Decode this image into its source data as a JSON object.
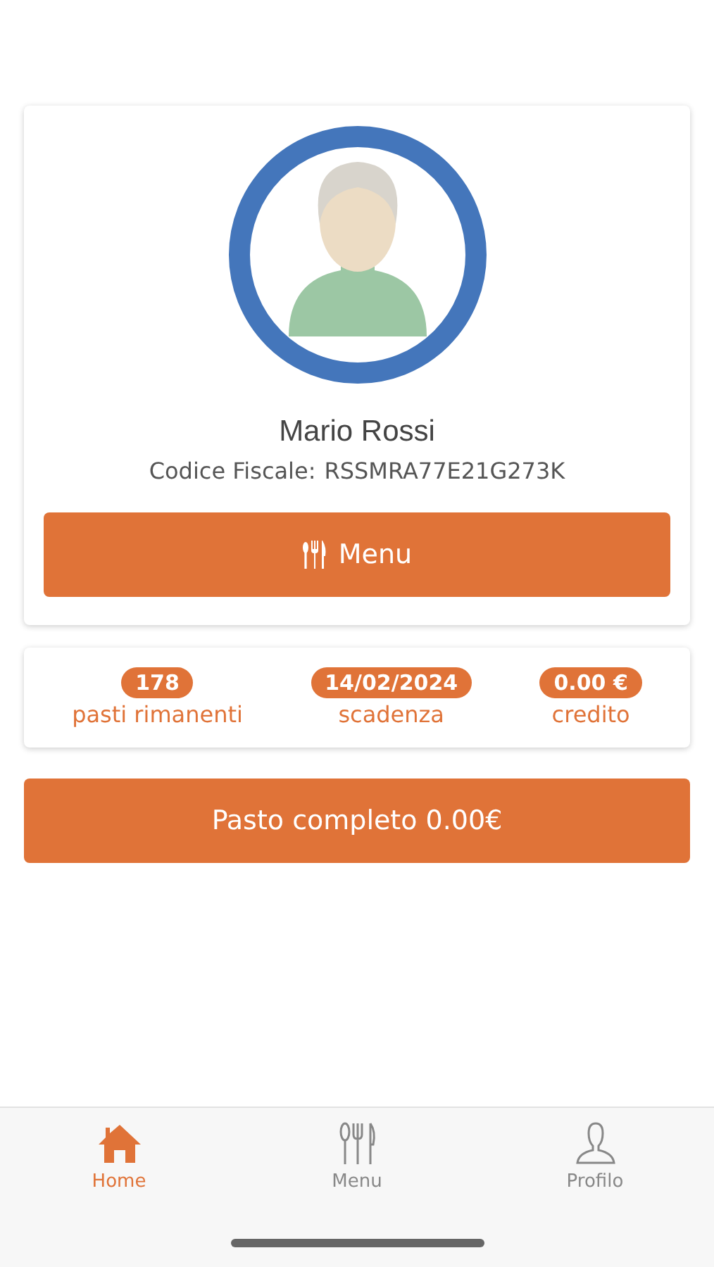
{
  "profile": {
    "name": "Mario Rossi",
    "tax_code_label": "Codice Fiscale:",
    "tax_code": "RSSMRA77E21G273K",
    "menu_button": "Menu"
  },
  "stats": [
    {
      "value": "178",
      "label": "pasti rimanenti"
    },
    {
      "value": "14/02/2024",
      "label": "scadenza"
    },
    {
      "value": "0.00 €",
      "label": "credito"
    }
  ],
  "meal_button": "Pasto completo 0.00€",
  "tabs": [
    {
      "label": "Home",
      "kind": "home",
      "selected": true
    },
    {
      "label": "Menu",
      "kind": "cutlery",
      "selected": false
    },
    {
      "label": "Profilo",
      "kind": "person",
      "selected": false
    }
  ]
}
